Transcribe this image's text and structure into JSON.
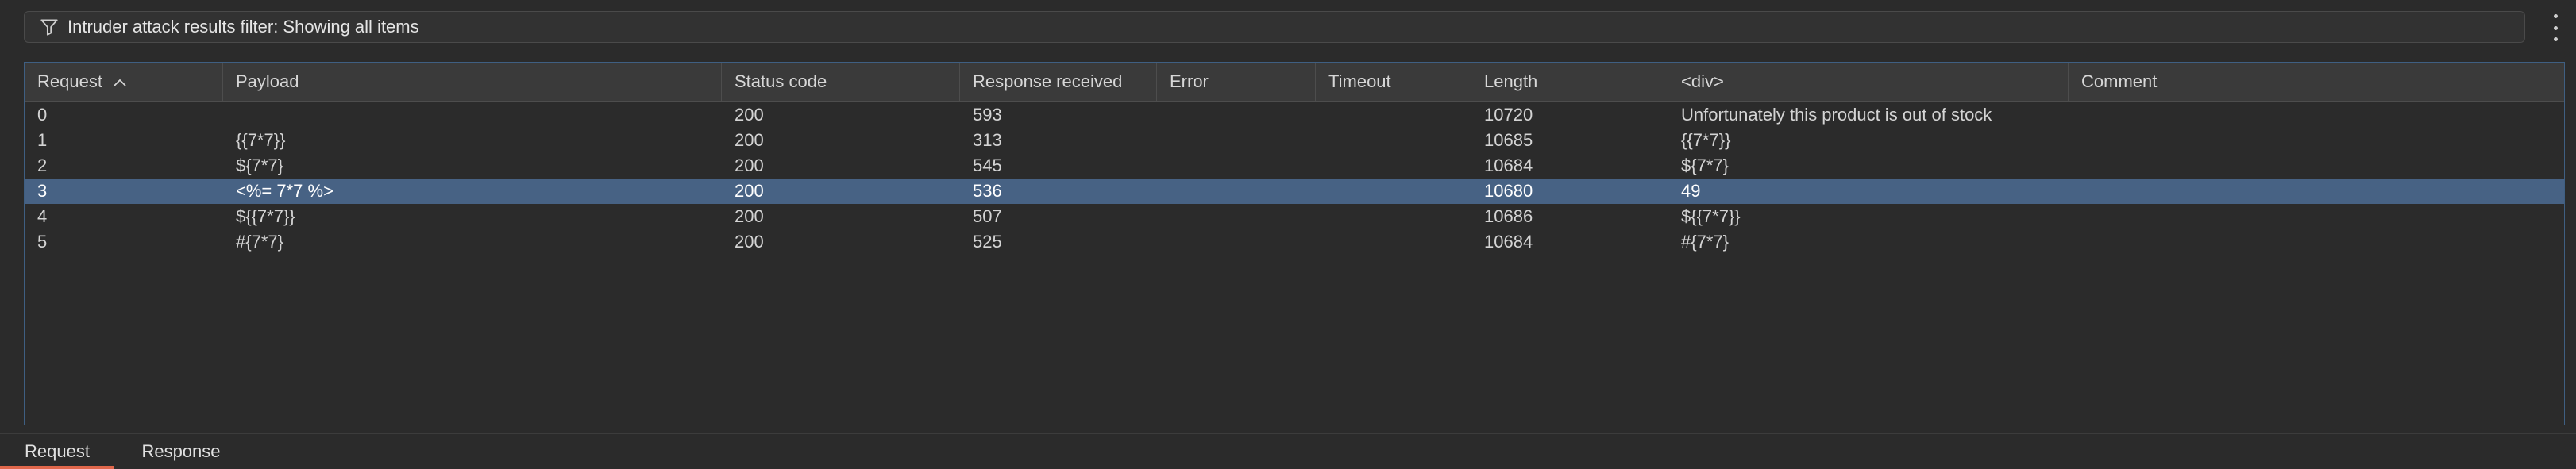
{
  "filter": {
    "text": "Intruder attack results filter: Showing all items",
    "icon": "filter-icon"
  },
  "colors": {
    "accent": "#e0674b",
    "selected_row": "#476284",
    "table_border": "#3f5f82"
  },
  "table": {
    "columns": [
      "Request",
      "Payload",
      "Status code",
      "Response received",
      "Error",
      "Timeout",
      "Length",
      "<div>",
      "Comment"
    ],
    "sort": {
      "column": "Request",
      "direction": "ascending"
    },
    "rows": [
      [
        "0",
        "",
        "200",
        "593",
        "",
        "",
        "10720",
        "Unfortunately this product is out of stock",
        ""
      ],
      [
        "1",
        "{{7*7}}",
        "200",
        "313",
        "",
        "",
        "10685",
        "{{7*7}}",
        ""
      ],
      [
        "2",
        "${7*7}",
        "200",
        "545",
        "",
        "",
        "10684",
        "${7*7}",
        ""
      ],
      [
        "3",
        "<%= 7*7 %>",
        "200",
        "536",
        "",
        "",
        "10680",
        "49",
        ""
      ],
      [
        "4",
        "${{7*7}}",
        "200",
        "507",
        "",
        "",
        "10686",
        "${{7*7}}",
        ""
      ],
      [
        "5",
        "#{7*7}",
        "200",
        "525",
        "",
        "",
        "10684",
        "#{7*7}",
        ""
      ]
    ],
    "selected_row": 3
  },
  "tabs": [
    {
      "label": "Request",
      "active": true
    },
    {
      "label": "Response",
      "active": false
    }
  ]
}
